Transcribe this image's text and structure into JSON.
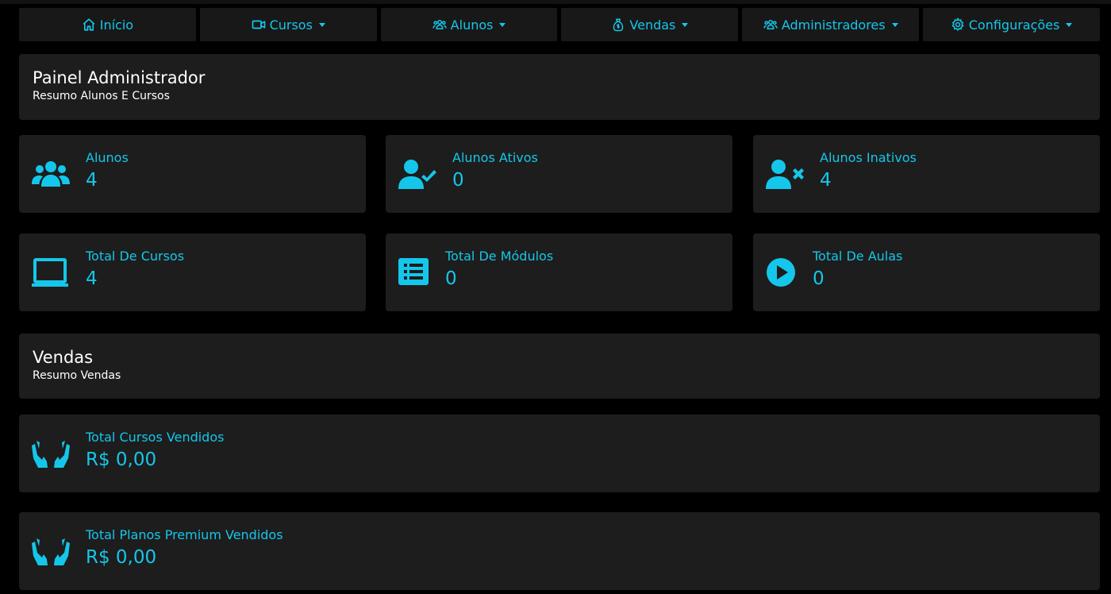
{
  "colors": {
    "accent": "#14c7ea",
    "panel": "#1d1d1d",
    "nav": "#181818",
    "background": "#000000"
  },
  "nav": {
    "items": [
      {
        "label": "Início",
        "icon": "home-icon",
        "dropdown": false
      },
      {
        "label": "Cursos",
        "icon": "video-icon",
        "dropdown": true
      },
      {
        "label": "Alunos",
        "icon": "users-icon",
        "dropdown": true
      },
      {
        "label": "Vendas",
        "icon": "money-bag-icon",
        "dropdown": true
      },
      {
        "label": "Administradores",
        "icon": "users-icon",
        "dropdown": true
      },
      {
        "label": "Configurações",
        "icon": "gear-icon",
        "dropdown": true
      }
    ]
  },
  "admin_panel": {
    "title": "Painel Administrador",
    "subtitle": "Resumo Alunos E Cursos"
  },
  "stats": [
    {
      "label": "Alunos",
      "value": "4",
      "icon": "users-icon"
    },
    {
      "label": "Alunos Ativos",
      "value": "0",
      "icon": "user-check-icon"
    },
    {
      "label": "Alunos Inativos",
      "value": "4",
      "icon": "user-times-icon"
    },
    {
      "label": "Total De Cursos",
      "value": "4",
      "icon": "laptop-icon"
    },
    {
      "label": "Total De Módulos",
      "value": "0",
      "icon": "list-icon"
    },
    {
      "label": "Total De Aulas",
      "value": "0",
      "icon": "play-circle-icon"
    }
  ],
  "sales_panel": {
    "title": "Vendas",
    "subtitle": "Resumo Vendas"
  },
  "sales": [
    {
      "label": "Total Cursos Vendidos",
      "value": "R$ 0,00",
      "icon": "hands-icon"
    },
    {
      "label": "Total Planos Premium Vendidos",
      "value": "R$ 0,00",
      "icon": "hands-icon"
    }
  ]
}
